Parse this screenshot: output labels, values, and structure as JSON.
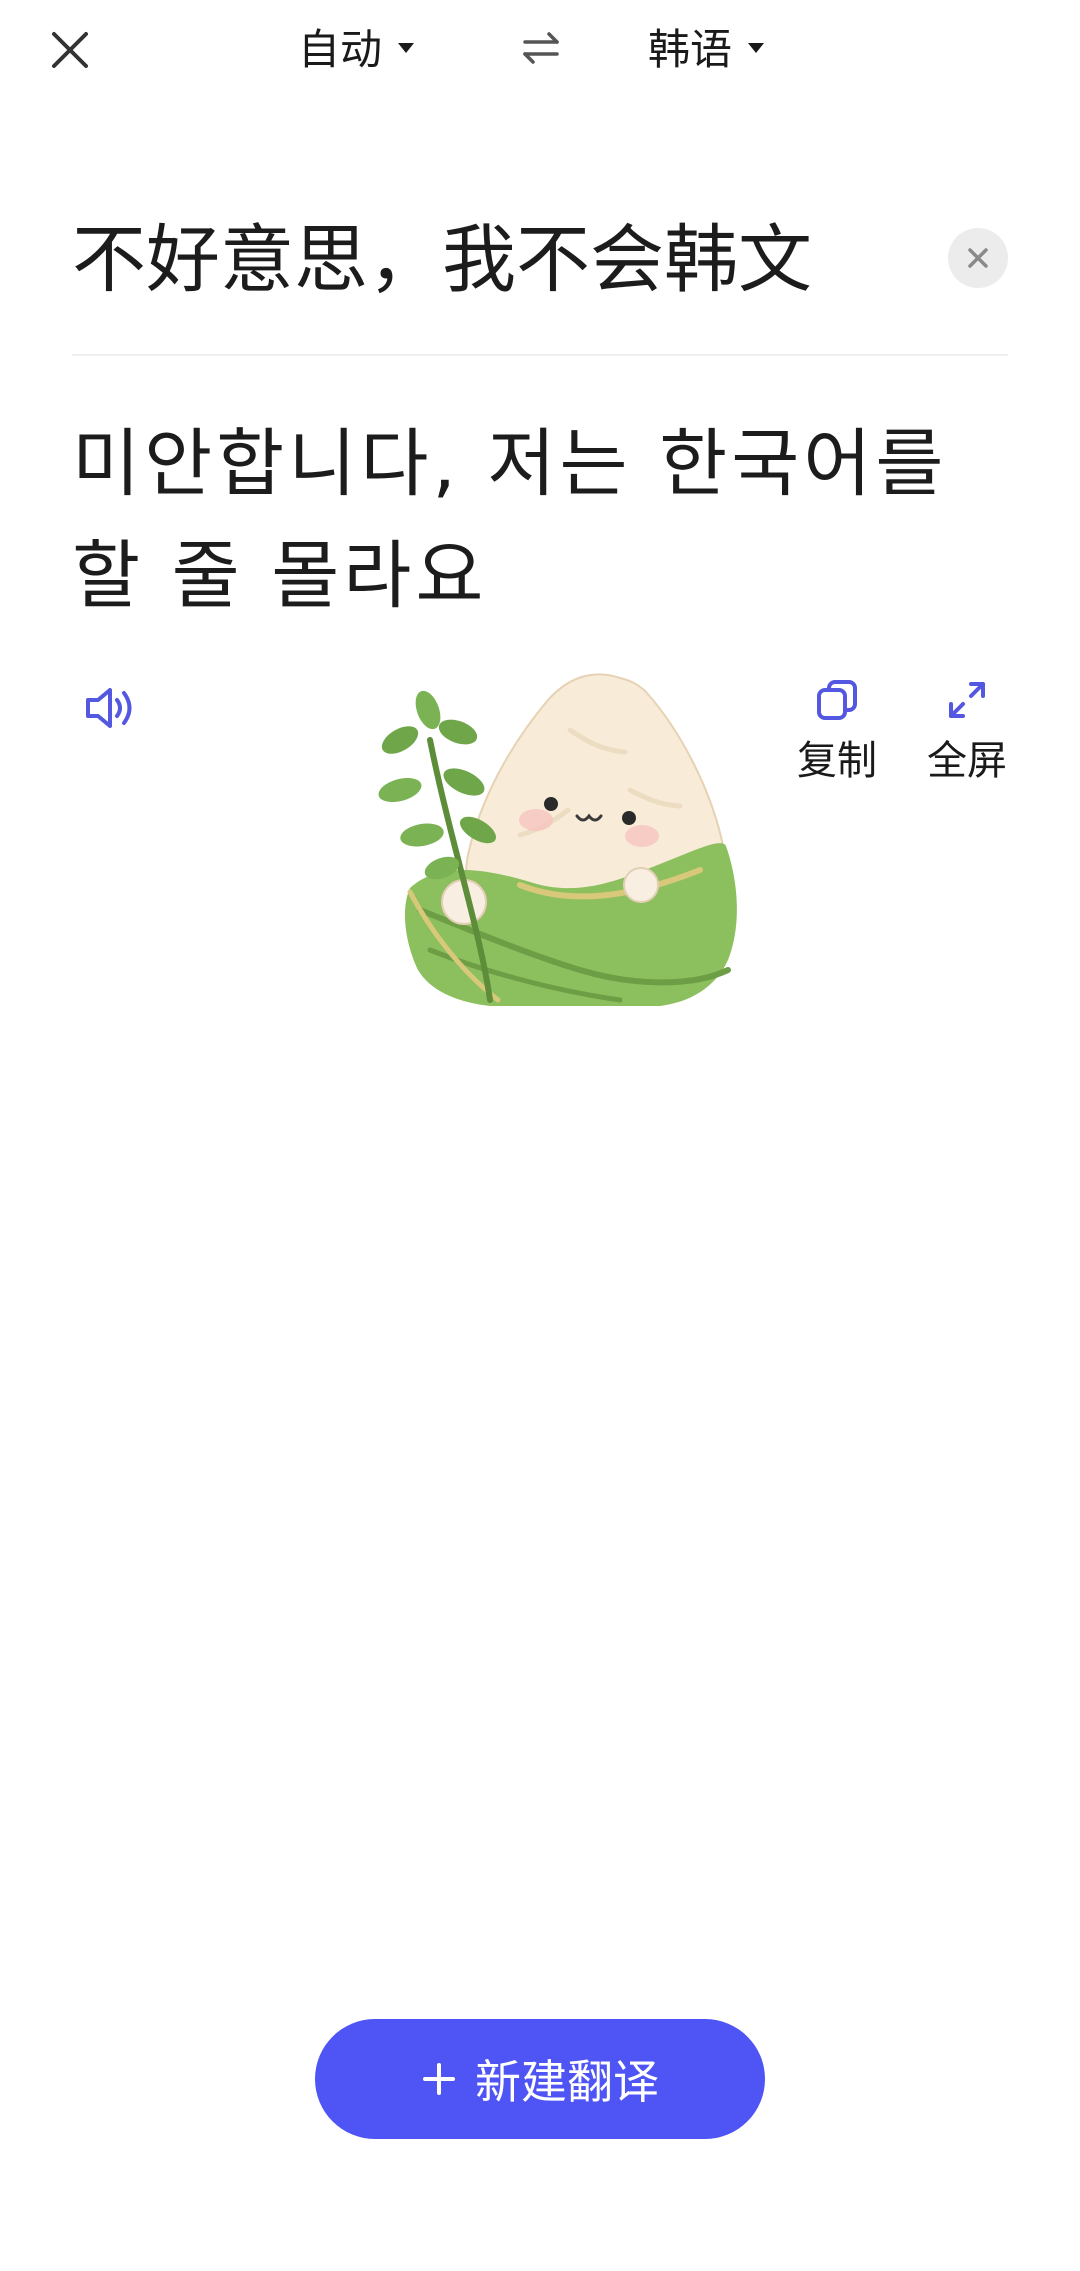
{
  "header": {
    "source_language": "自动",
    "target_language": "韩语"
  },
  "source": {
    "text": "不好意思，我不会韩文"
  },
  "translation": {
    "line1": "미안합니다, 저는 한국어를",
    "line2": "할 줄 몰라요"
  },
  "actions": {
    "copy_label": "复制",
    "fullscreen_label": "全屏"
  },
  "footer": {
    "new_translation_label": "新建翻译"
  },
  "icons": {
    "close": "close-icon",
    "swap": "swap-icon",
    "clear": "clear-icon",
    "speaker": "speaker-icon",
    "copy": "copy-icon",
    "fullscreen": "expand-icon",
    "plus": "plus-icon"
  },
  "colors": {
    "accent": "#4f54f5",
    "icon_accent": "#5457e0",
    "text": "#1c1c1c",
    "divider": "#efefef",
    "clear_bg": "#ececec"
  }
}
